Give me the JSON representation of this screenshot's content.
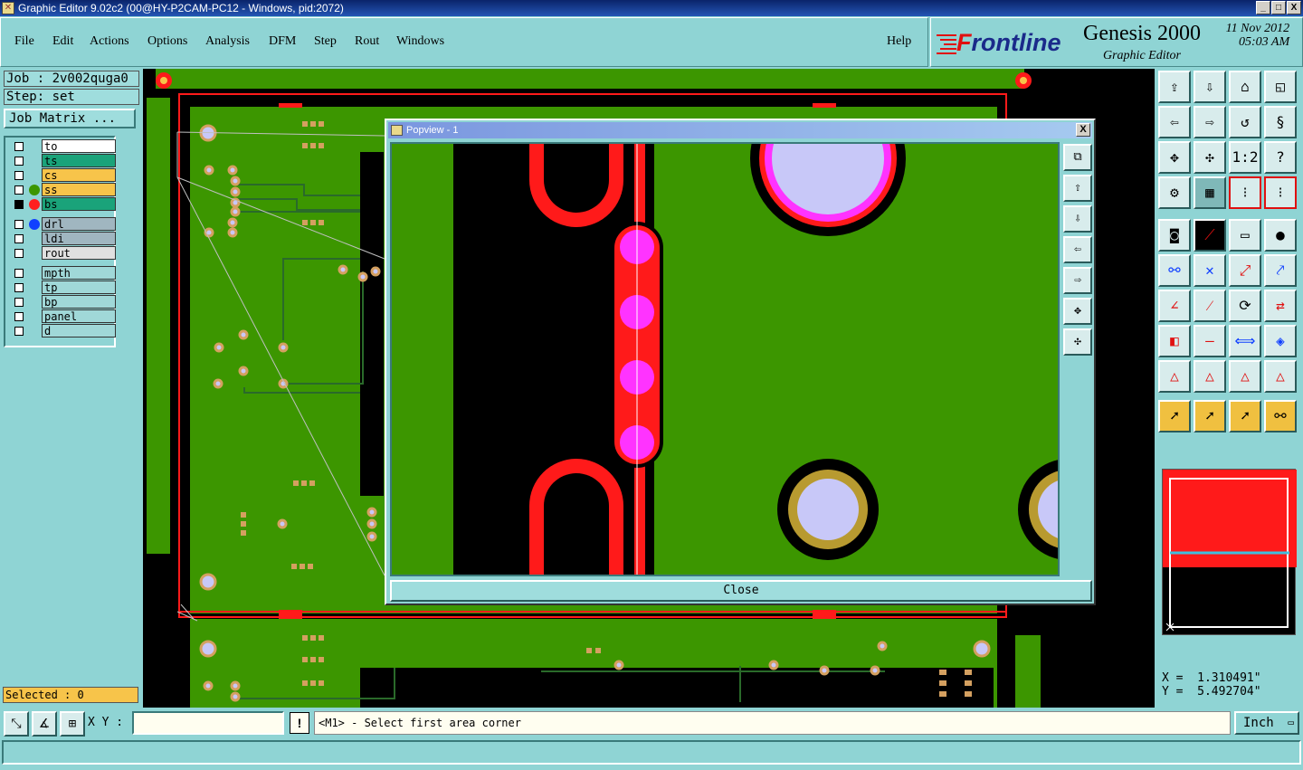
{
  "window": {
    "title": "Graphic Editor 9.02c2 (00@HY-P2CAM-PC12 - Windows, pid:2072)",
    "btn_min": "_",
    "btn_max": "□",
    "btn_close": "X"
  },
  "menu": {
    "file": "File",
    "edit": "Edit",
    "actions": "Actions",
    "options": "Options",
    "analysis": "Analysis",
    "dfm": "DFM",
    "step": "Step",
    "rout": "Rout",
    "windows": "Windows",
    "help": "Help"
  },
  "logo": {
    "brand": "Frontline",
    "product": "Genesis 2000",
    "subtitle": "Graphic Editor",
    "date": "11 Nov 2012",
    "time": "05:03 AM"
  },
  "job": {
    "job_label": "Job : 2v002quga0",
    "step_label": "Step: set",
    "matrix_button": "Job Matrix ..."
  },
  "layers": [
    {
      "name": "to",
      "bg": "#ffffff",
      "dot": ""
    },
    {
      "name": "ts",
      "bg": "#1aa37a",
      "dot": ""
    },
    {
      "name": "cs",
      "bg": "#f7c44a",
      "dot": ""
    },
    {
      "name": "ss",
      "bg": "#f7c44a",
      "dot": "#3c9600"
    },
    {
      "name": "bs",
      "bg": "#1aa37a",
      "dot": "#ff2020"
    },
    {
      "name": "drl",
      "bg": "#a0b6c0",
      "dot": "#1040ff"
    },
    {
      "name": "ldi",
      "bg": "#a0b6c0",
      "dot": ""
    },
    {
      "name": "rout",
      "bg": "#e0e0e0",
      "dot": ""
    },
    {
      "name": "mpth",
      "bg": "#a0d8d8",
      "dot": ""
    },
    {
      "name": "tp",
      "bg": "#a0d8d8",
      "dot": ""
    },
    {
      "name": "bp",
      "bg": "#a0d8d8",
      "dot": ""
    },
    {
      "name": "panel",
      "bg": "#a0d8d8",
      "dot": ""
    },
    {
      "name": "d",
      "bg": "#a0d8d8",
      "dot": ""
    }
  ],
  "selected": "Selected : 0",
  "popview": {
    "title": "Popview - 1",
    "close_x": "X",
    "close_button": "Close"
  },
  "coords": {
    "x": "X =  1.310491\"",
    "y": "Y =  5.492704\""
  },
  "bottom": {
    "xy_label": "X Y :",
    "xy_value": "",
    "bang": "!",
    "prompt": "<M1> - Select first area corner",
    "unit": "Inch"
  },
  "toolbox_labels": {
    "scale": "1:2",
    "help": "?"
  },
  "colors": {
    "board": "#3c9600",
    "copper": "#ff1a1a",
    "pad": "#ff33ff",
    "hole": "#c8c8f8",
    "panel_bg": "#8fd4d4"
  }
}
